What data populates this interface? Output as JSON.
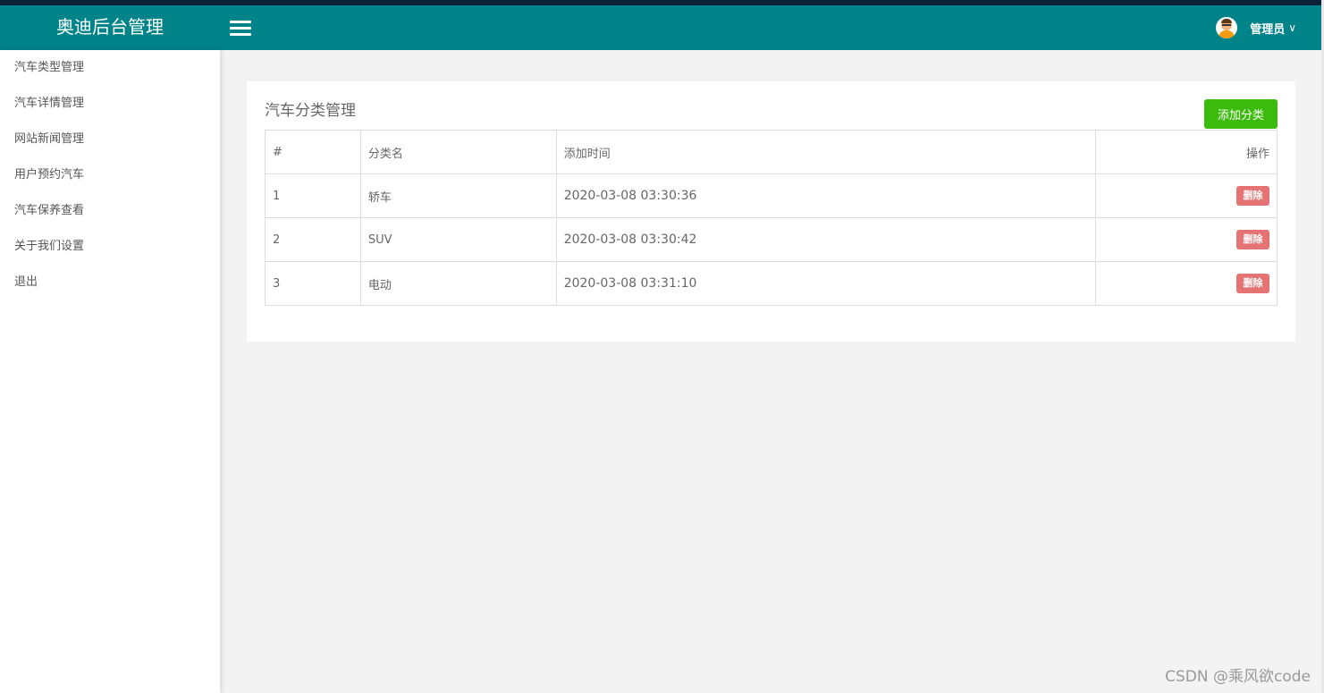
{
  "header": {
    "brand": "奥迪后台管理",
    "user_name": "管理员",
    "user_chevron": "∨"
  },
  "sidebar": {
    "items": [
      {
        "label": "汽车类型管理"
      },
      {
        "label": "汽车详情管理"
      },
      {
        "label": "网站新闻管理"
      },
      {
        "label": "用户预约汽车"
      },
      {
        "label": "汽车保养查看"
      },
      {
        "label": "关于我们设置"
      },
      {
        "label": "退出"
      }
    ]
  },
  "main": {
    "title": "汽车分类管理",
    "add_button": "添加分类",
    "table": {
      "headers": [
        "#",
        "分类名",
        "添加时间",
        "操作"
      ],
      "rows": [
        {
          "id": "1",
          "name": "轿车",
          "time": "2020-03-08 03:30:36",
          "action": "删除"
        },
        {
          "id": "2",
          "name": "SUV",
          "time": "2020-03-08 03:30:42",
          "action": "删除"
        },
        {
          "id": "3",
          "name": "电动",
          "time": "2020-03-08 03:31:10",
          "action": "删除"
        }
      ]
    }
  },
  "watermark": "CSDN @乘风欲code",
  "colors": {
    "header": "#008389",
    "add_button": "#3bbc0c",
    "delete_button": "#e57373"
  },
  "icons": {
    "menu": "hamburger-icon",
    "avatar": "avatar-icon"
  }
}
